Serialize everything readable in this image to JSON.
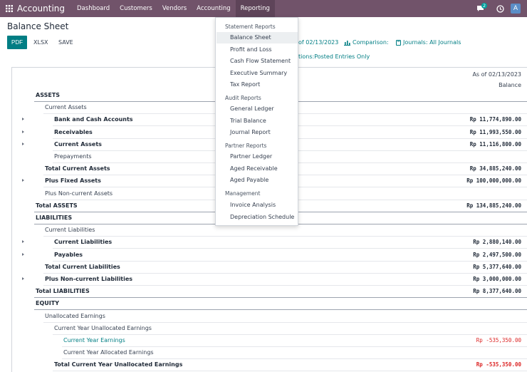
{
  "navbar": {
    "brand": "Accounting",
    "menus": [
      "Dashboard",
      "Customers",
      "Vendors",
      "Accounting",
      "Reporting"
    ],
    "active_menu": "Reporting",
    "chat_badge": "2",
    "avatar_letter": "A",
    "bg_color": "#71536a"
  },
  "control": {
    "title": "Balance Sheet",
    "pdf": "PDF",
    "xlsx": "XLSX",
    "save": "SAVE",
    "filter_date": "of 02/13/2023",
    "filter_comparison": "Comparison:",
    "filter_journals": "Journals: All Journals",
    "filter_options": "tions:Posted Entries Only"
  },
  "report": {
    "col_date": "As of 02/13/2023",
    "col_balance": "Balance",
    "rows": [
      {
        "label": "ASSETS",
        "value": "",
        "level": 0,
        "bold": true,
        "caret": false
      },
      {
        "label": "Current Assets",
        "value": "",
        "level": 1,
        "bold": false,
        "caret": false
      },
      {
        "label": "Bank and Cash Accounts",
        "value": "Rp 11,774,890.00",
        "level": 2,
        "bold": true,
        "caret": true
      },
      {
        "label": "Receivables",
        "value": "Rp 11,993,550.00",
        "level": 2,
        "bold": true,
        "caret": true
      },
      {
        "label": "Current Assets",
        "value": "Rp 11,116,800.00",
        "level": 2,
        "bold": true,
        "caret": true
      },
      {
        "label": "Prepayments",
        "value": "",
        "level": 2,
        "bold": false,
        "caret": false
      },
      {
        "label": "Total Current Assets",
        "value": "Rp 34,885,240.00",
        "level": 1,
        "bold": true,
        "caret": false
      },
      {
        "label": "Plus Fixed Assets",
        "value": "Rp 100,000,000.00",
        "level": 1,
        "bold": true,
        "caret": true
      },
      {
        "label": "Plus Non-current Assets",
        "value": "",
        "level": 1,
        "bold": false,
        "caret": false
      },
      {
        "label": "Total ASSETS",
        "value": "Rp 134,885,240.00",
        "level": 0,
        "bold": true,
        "caret": false
      },
      {
        "label": "LIABILITIES",
        "value": "",
        "level": 0,
        "bold": true,
        "caret": false
      },
      {
        "label": "Current Liabilities",
        "value": "",
        "level": 1,
        "bold": false,
        "caret": false
      },
      {
        "label": "Current Liabilities",
        "value": "Rp 2,880,140.00",
        "level": 2,
        "bold": true,
        "caret": true
      },
      {
        "label": "Payables",
        "value": "Rp 2,497,500.00",
        "level": 2,
        "bold": true,
        "caret": true
      },
      {
        "label": "Total Current Liabilities",
        "value": "Rp 5,377,640.00",
        "level": 1,
        "bold": true,
        "caret": false
      },
      {
        "label": "Plus Non-current Liabilities",
        "value": "Rp 3,000,000.00",
        "level": 1,
        "bold": true,
        "caret": true
      },
      {
        "label": "Total LIABILITIES",
        "value": "Rp 8,377,640.00",
        "level": 0,
        "bold": true,
        "caret": false
      },
      {
        "label": "EQUITY",
        "value": "",
        "level": 0,
        "bold": true,
        "caret": false
      },
      {
        "label": "Unallocated Earnings",
        "value": "",
        "level": 1,
        "bold": false,
        "caret": false
      },
      {
        "label": "Current Year Unallocated Earnings",
        "value": "",
        "level": 2,
        "bold": false,
        "caret": false
      },
      {
        "label": "Current Year Earnings",
        "value": "Rp -535,350.00",
        "level": 3,
        "bold": false,
        "caret": false,
        "link": true,
        "negative": true
      },
      {
        "label": "Current Year Allocated Earnings",
        "value": "",
        "level": 3,
        "bold": false,
        "caret": false
      },
      {
        "label": "Total Current Year Unallocated Earnings",
        "value": "Rp -535,350.00",
        "level": 2,
        "bold": true,
        "caret": false,
        "negative": true
      }
    ]
  },
  "dropdown": {
    "groups": [
      {
        "header": "Statement Reports",
        "items": [
          "Balance Sheet",
          "Profit and Loss",
          "Cash Flow Statement",
          "Executive Summary",
          "Tax Report"
        ]
      },
      {
        "header": "Audit Reports",
        "items": [
          "General Ledger",
          "Trial Balance",
          "Journal Report"
        ]
      },
      {
        "header": "Partner Reports",
        "items": [
          "Partner Ledger",
          "Aged Receivable",
          "Aged Payable"
        ]
      },
      {
        "header": "Management",
        "items": [
          "Invoice Analysis",
          "Depreciation Schedule"
        ]
      }
    ],
    "active_item": "Balance Sheet"
  }
}
